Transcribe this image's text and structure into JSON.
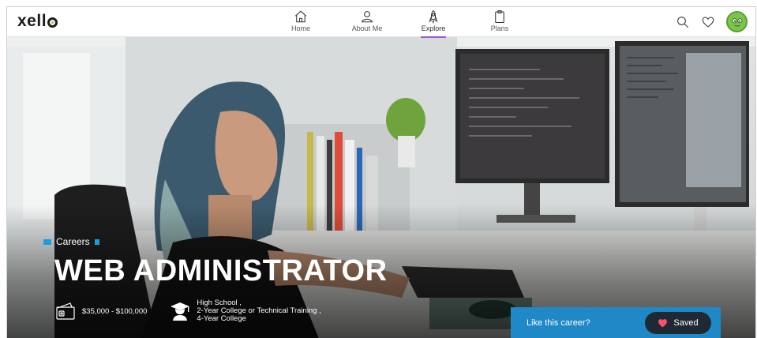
{
  "brand": {
    "name": "xello"
  },
  "nav": {
    "items": [
      {
        "label": "Home",
        "icon": "home-icon"
      },
      {
        "label": "About Me",
        "icon": "person-icon"
      },
      {
        "label": "Explore",
        "icon": "rocket-icon",
        "active": true
      },
      {
        "label": "Plans",
        "icon": "clipboard-icon"
      }
    ]
  },
  "header_actions": {
    "search_icon": "search-icon",
    "favorites_icon": "heart-icon",
    "avatar_icon": "avatar"
  },
  "hero": {
    "breadcrumb": "Careers",
    "title": "WEB ADMINISTRATOR",
    "salary": "$35,000 - $100,000",
    "education": {
      "line1": "High School ,",
      "line2": "2-Year College or Technical Training ,",
      "line3": "4-Year College"
    }
  },
  "like_bar": {
    "prompt": "Like this career?",
    "saved_label": "Saved"
  },
  "colors": {
    "accent_blue": "#1f88c7",
    "active_underline": "#9b59d0",
    "heart": "#ff4d6d",
    "brand_green": "#8cc63f"
  }
}
